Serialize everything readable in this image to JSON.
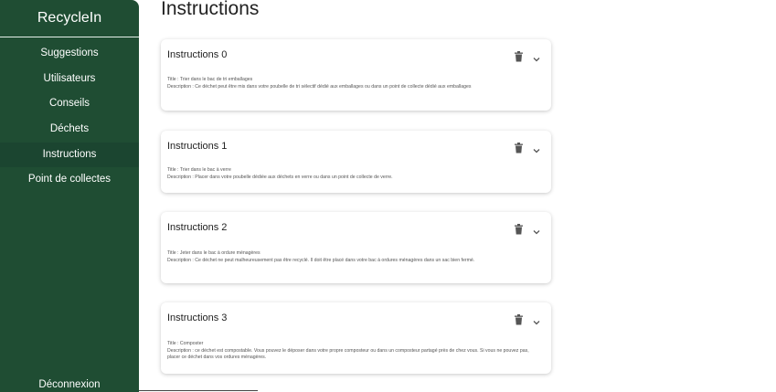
{
  "app": {
    "title": "RecycleIn"
  },
  "sidebar": {
    "items": [
      {
        "label": "Suggestions"
      },
      {
        "label": "Utilisateurs"
      },
      {
        "label": "Conseils"
      },
      {
        "label": "Déchets"
      },
      {
        "label": "Instructions",
        "active": true
      },
      {
        "label": "Point de collectes"
      }
    ],
    "logout_label": "Déconnexion"
  },
  "main": {
    "title": "Instructions",
    "cards": [
      {
        "title": "Instructions 0",
        "titre_line": "Title : Trier dans le bac de tri emballages",
        "description_line": "Description : Ce déchet peut être mis dans votre poubelle de tri sélectif dédié aux emballages ou dans un point de collecte dédié aux emballages"
      },
      {
        "title": "Instructions 1",
        "titre_line": "Title : Trier dans le bac à verre",
        "description_line": "Description : Placer dans votre poubelle dédiée aux déchets en verre ou dans un point de collecte de verre."
      },
      {
        "title": "Instructions 2",
        "titre_line": "Title : Jeter dans le bac à ordure ménagères",
        "description_line": "Description : Ce déchet ne peut malheureusement pas être recyclé. Il doit être placé dans votre bac à ordures ménagères dans un sac bien fermé."
      },
      {
        "title": "Instructions 3",
        "titre_line": "Title : Composter",
        "description_line": "Description : ce déchet est compostable. Vous pouvez le déposer dans votre propre composteur ou dans un composteur partagé près de chez vous. Si vous ne pouvez pas, placer ce déchet dans vos ordures ménagères."
      }
    ]
  },
  "icons": {
    "delete": "trash-icon",
    "expand": "chevron-down-icon"
  },
  "colors": {
    "sidebar_bg": "#1f4d33",
    "sidebar_text": "#ffffff",
    "icon_gray": "#555555"
  }
}
